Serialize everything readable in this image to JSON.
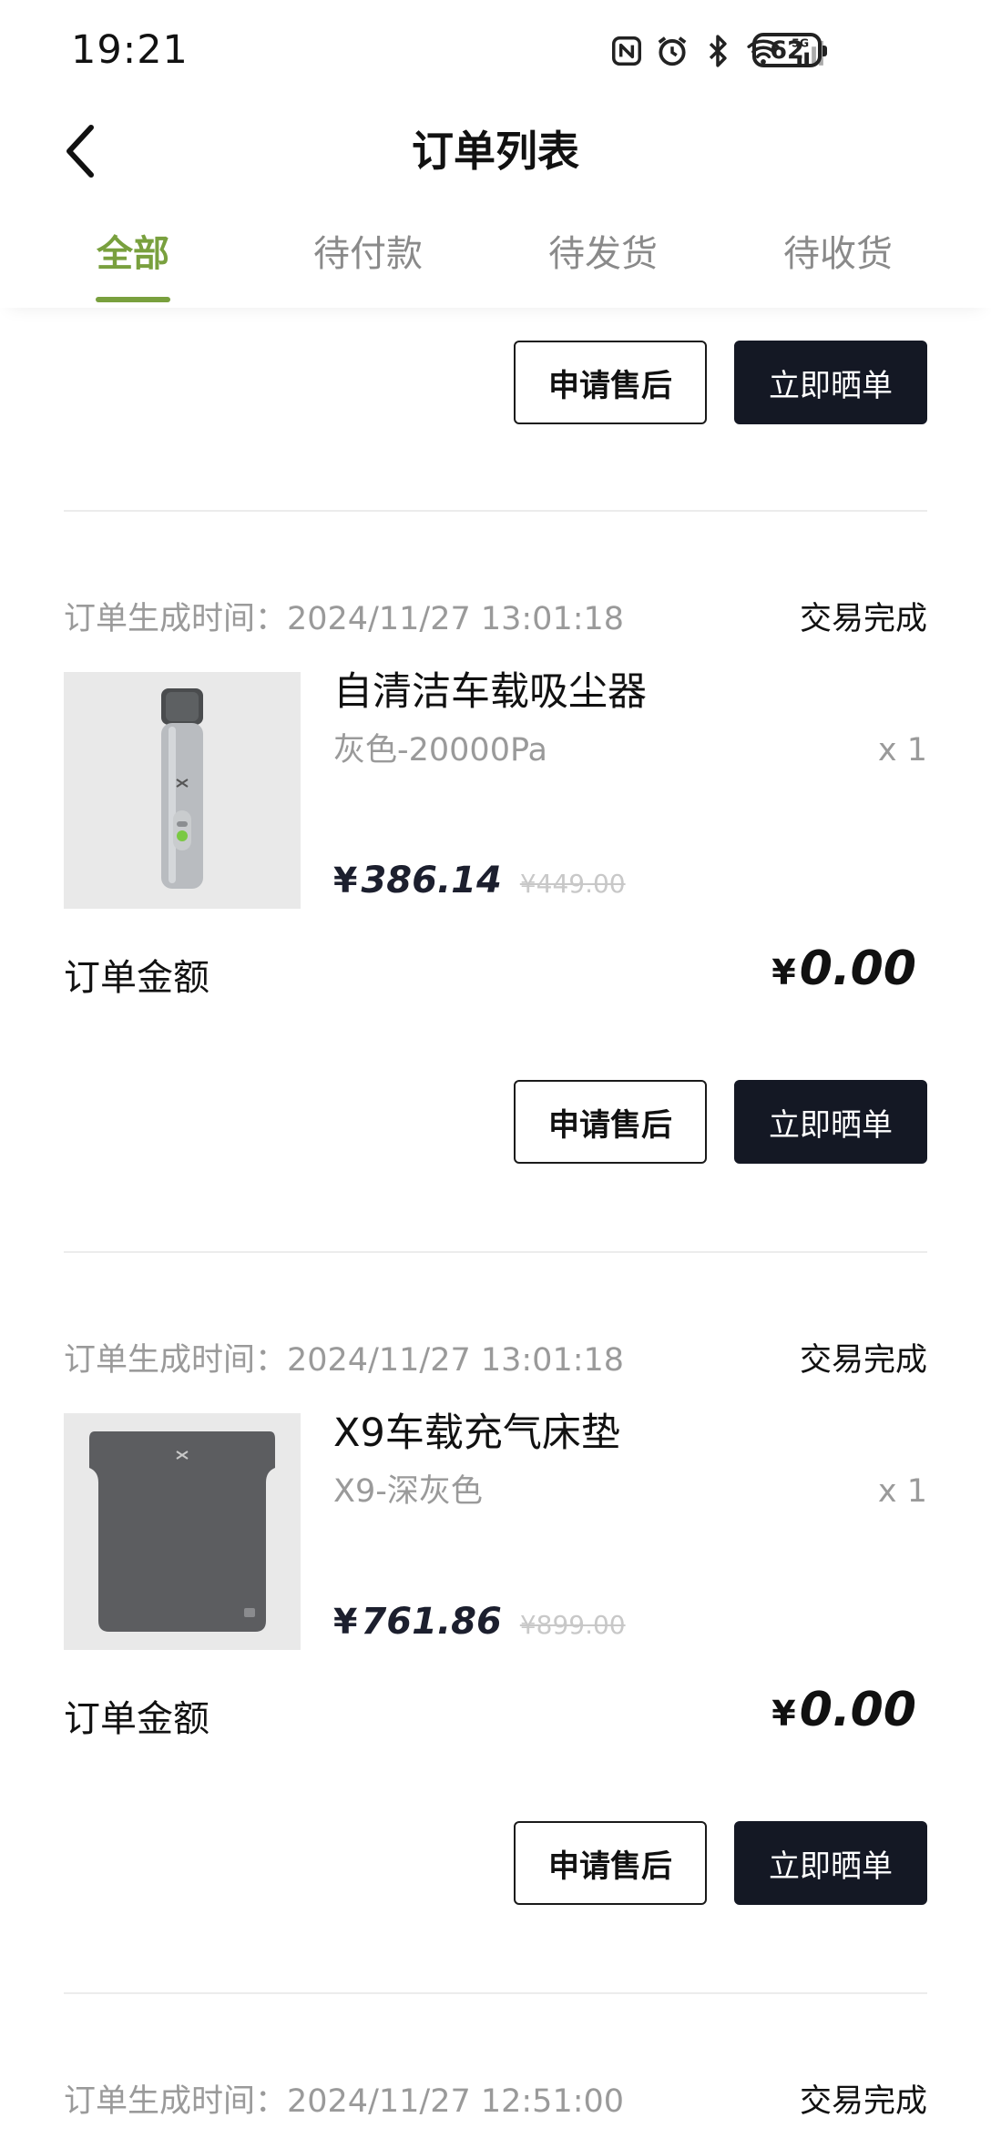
{
  "status_bar": {
    "time": "19:21",
    "icons": [
      "nfc-icon",
      "alarm-icon",
      "bluetooth-icon",
      "wifi-icon",
      "signal-5g-icon"
    ],
    "battery": "62"
  },
  "header": {
    "title": "订单列表",
    "back_icon": "chevron-left-icon"
  },
  "tabs": {
    "items": [
      {
        "label": "全部",
        "active": true
      },
      {
        "label": "待付款",
        "active": false
      },
      {
        "label": "待发货",
        "active": false
      },
      {
        "label": "待收货",
        "active": false
      }
    ],
    "accent_color": "#79a03e"
  },
  "buttons": {
    "after_sales": "申请售后",
    "share_review": "立即晒单"
  },
  "orders": [
    {
      "time_label": "订单生成时间：2024/11/27 13:01:18",
      "status": "交易完成",
      "product": {
        "name": "自清洁车载吸尘器",
        "spec": "灰色-20000Pa",
        "qty": "x 1",
        "currency": "¥",
        "price": "386.14",
        "original_price": "¥449.00",
        "image": "vacuum-cleaner-image"
      },
      "amount_label": "订单金额",
      "amount_currency": "¥",
      "amount": "0.00"
    },
    {
      "time_label": "订单生成时间：2024/11/27 13:01:18",
      "status": "交易完成",
      "product": {
        "name": "X9车载充气床垫",
        "spec": "X9-深灰色",
        "qty": "x 1",
        "currency": "¥",
        "price": "761.86",
        "original_price": "¥899.00",
        "image": "air-mattress-image"
      },
      "amount_label": "订单金额",
      "amount_currency": "¥",
      "amount": "0.00"
    },
    {
      "time_label": "订单生成时间：2024/11/27 12:51:00",
      "status": "交易完成"
    }
  ]
}
